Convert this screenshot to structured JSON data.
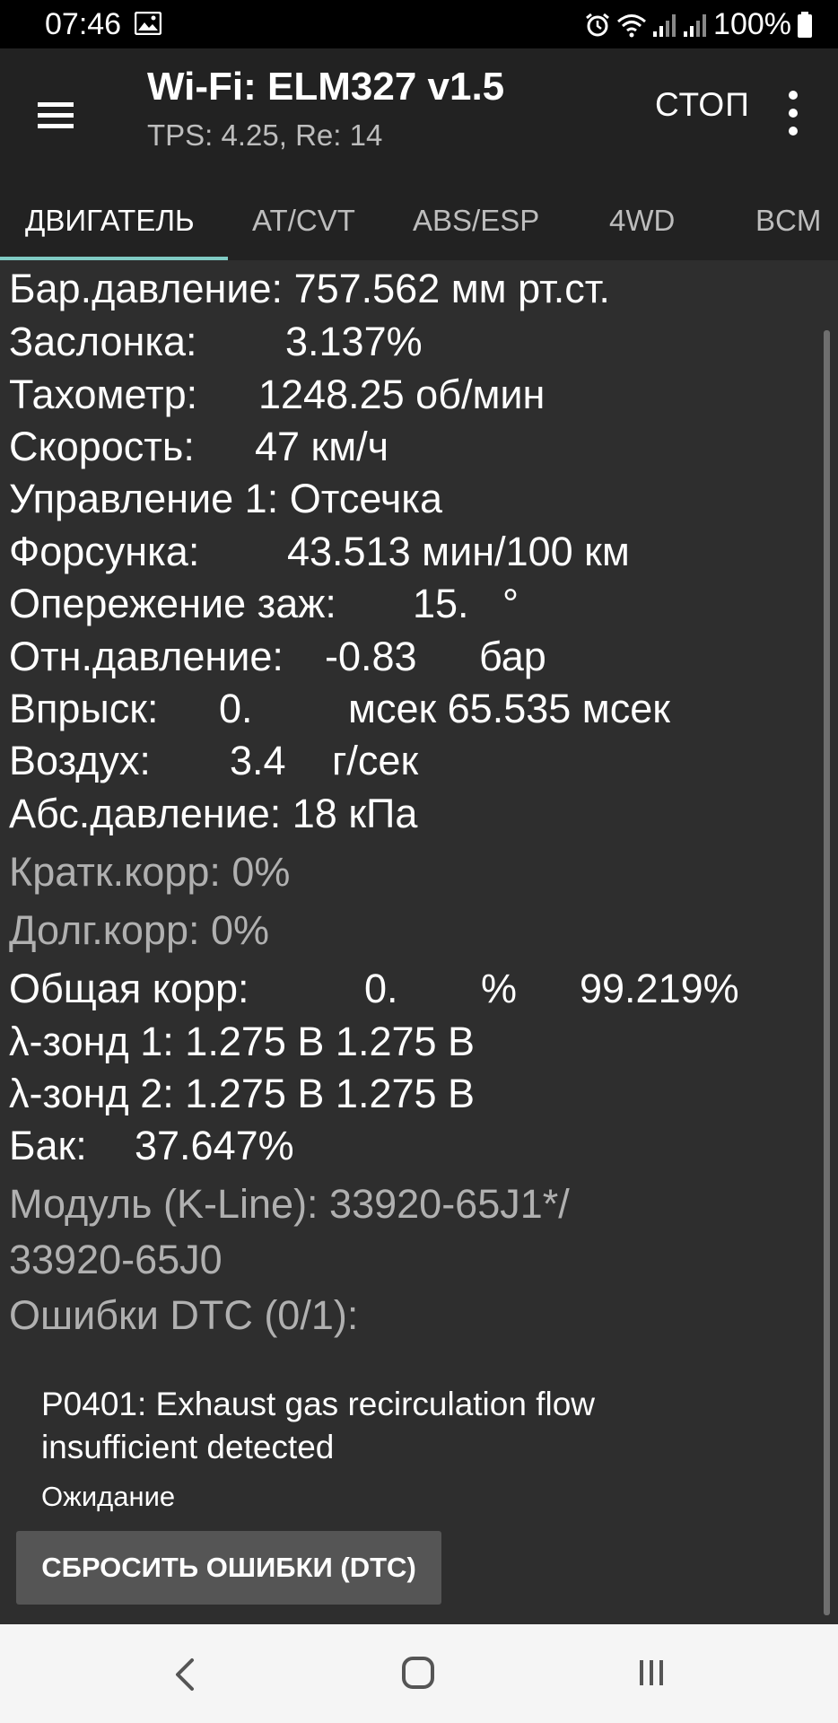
{
  "status_bar": {
    "time": "07:46",
    "battery": "100%",
    "icons": [
      "gallery-icon",
      "alarm-icon",
      "wifi-icon",
      "signal-icon",
      "signal-icon",
      "battery-icon"
    ]
  },
  "app_bar": {
    "title": "Wi-Fi: ELM327 v1.5",
    "subtitle": "TPS: 4.25, Re: 14",
    "stop_label": "СТОП",
    "menu_icon": "hamburger-menu-icon",
    "more_icon": "more-vertical-icon"
  },
  "tabs": [
    {
      "label": "ДВИГАТЕЛЬ",
      "active": true
    },
    {
      "label": "AT/CVT",
      "active": false
    },
    {
      "label": "ABS/ESP",
      "active": false
    },
    {
      "label": "4WD",
      "active": false
    },
    {
      "label": "BCM",
      "active": false
    }
  ],
  "params": {
    "baro": {
      "label": "Бар.давление:",
      "value": "757.562 мм рт.ст."
    },
    "throttle": {
      "label": "Заслонка:",
      "value": "3.137%"
    },
    "rpm": {
      "label": "Тахометр:",
      "value": "1248.25 об/мин"
    },
    "speed": {
      "label": "Скорость:",
      "value": "47 км/ч"
    },
    "control1": {
      "label": "Управление 1:",
      "value": "Отсечка"
    },
    "injector": {
      "label": "Форсунка:",
      "value": "43.513 мин/100 км"
    },
    "ignition": {
      "label": "Опережение заж:",
      "value": "15.",
      "unit": "°"
    },
    "rel_pressure": {
      "label": "Отн.давление:",
      "value": "-0.83",
      "unit": "бар"
    },
    "injection": {
      "label": "Впрыск:",
      "value": "0.",
      "unit": "мсек 65.535 мсек"
    },
    "air": {
      "label": "Воздух:",
      "value": "3.4",
      "unit": "г/сек"
    },
    "abs_pressure": {
      "label": "Абс.давление:",
      "value": "18 кПа"
    },
    "short_trim": {
      "label": "Кратк.корр:",
      "value": "0%"
    },
    "long_trim": {
      "label": "Долг.корр:",
      "value": "0%"
    },
    "total_trim": {
      "label": "Общая корр:",
      "value": "0.",
      "unit": "%",
      "extra": "99.219%"
    },
    "lambda1": {
      "label": "λ-зонд 1:",
      "value": "1.275 В 1.275 В"
    },
    "lambda2": {
      "label": "λ-зонд 2:",
      "value": "1.275 В 1.275 В"
    },
    "tank": {
      "label": "Бак:",
      "value": "37.647%"
    }
  },
  "module": {
    "line1": "Модуль (K-Line): 33920-65J1*/",
    "line2": "33920-65J0"
  },
  "dtc": {
    "header": "Ошибки DTC (0/1):",
    "entry_line1": "P0401: Exhaust gas recirculation flow",
    "entry_line2": "insufficient detected",
    "status": "Ожидание",
    "reset_label": "СБРОСИТЬ ОШИБКИ (DTC)"
  },
  "nav_bar": {
    "icons": [
      "back-icon",
      "home-icon",
      "recent-apps-icon"
    ]
  }
}
